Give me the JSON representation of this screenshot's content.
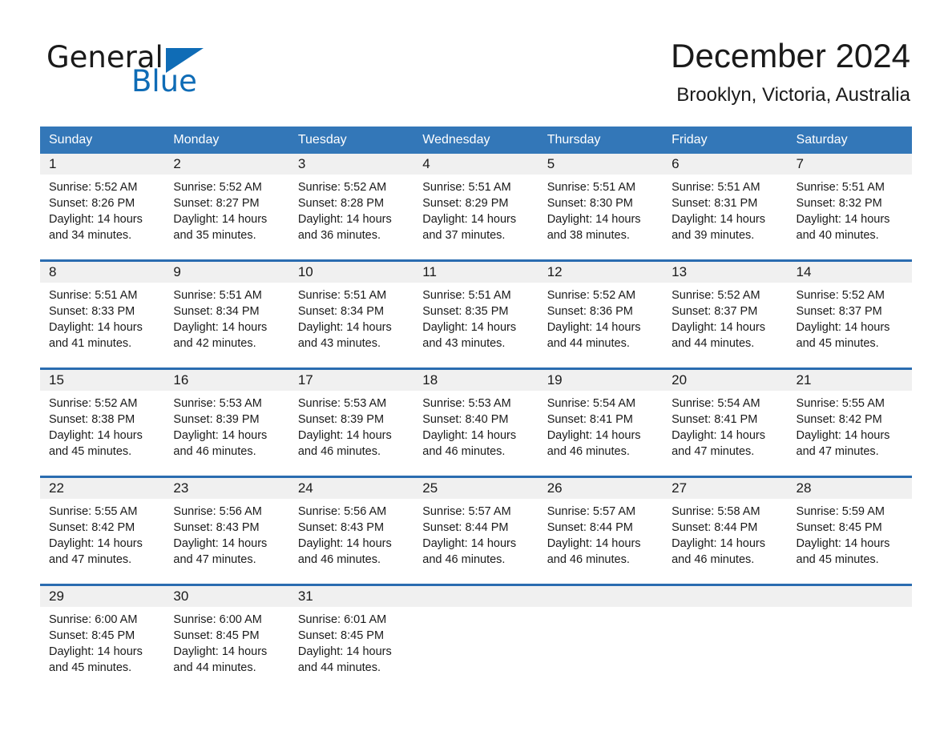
{
  "logo": {
    "word_one": "General",
    "word_two": "Blue",
    "triangle_color": "#0f6cb6",
    "icon": "triangle-logo-icon"
  },
  "header": {
    "month_title": "December 2024",
    "location": "Brooklyn, Victoria, Australia"
  },
  "colors": {
    "header_blue": "#3377b8",
    "row_divider_blue": "#2a6cb0",
    "daynum_background": "#f0f0f0",
    "brand_blue": "#0f6cb6"
  },
  "calendar": {
    "weekday_headers": [
      "Sunday",
      "Monday",
      "Tuesday",
      "Wednesday",
      "Thursday",
      "Friday",
      "Saturday"
    ],
    "weeks": [
      [
        {
          "day": "1",
          "sunrise": "Sunrise: 5:52 AM",
          "sunset": "Sunset: 8:26 PM",
          "daylight_line1": "Daylight: 14 hours",
          "daylight_line2": "and 34 minutes."
        },
        {
          "day": "2",
          "sunrise": "Sunrise: 5:52 AM",
          "sunset": "Sunset: 8:27 PM",
          "daylight_line1": "Daylight: 14 hours",
          "daylight_line2": "and 35 minutes."
        },
        {
          "day": "3",
          "sunrise": "Sunrise: 5:52 AM",
          "sunset": "Sunset: 8:28 PM",
          "daylight_line1": "Daylight: 14 hours",
          "daylight_line2": "and 36 minutes."
        },
        {
          "day": "4",
          "sunrise": "Sunrise: 5:51 AM",
          "sunset": "Sunset: 8:29 PM",
          "daylight_line1": "Daylight: 14 hours",
          "daylight_line2": "and 37 minutes."
        },
        {
          "day": "5",
          "sunrise": "Sunrise: 5:51 AM",
          "sunset": "Sunset: 8:30 PM",
          "daylight_line1": "Daylight: 14 hours",
          "daylight_line2": "and 38 minutes."
        },
        {
          "day": "6",
          "sunrise": "Sunrise: 5:51 AM",
          "sunset": "Sunset: 8:31 PM",
          "daylight_line1": "Daylight: 14 hours",
          "daylight_line2": "and 39 minutes."
        },
        {
          "day": "7",
          "sunrise": "Sunrise: 5:51 AM",
          "sunset": "Sunset: 8:32 PM",
          "daylight_line1": "Daylight: 14 hours",
          "daylight_line2": "and 40 minutes."
        }
      ],
      [
        {
          "day": "8",
          "sunrise": "Sunrise: 5:51 AM",
          "sunset": "Sunset: 8:33 PM",
          "daylight_line1": "Daylight: 14 hours",
          "daylight_line2": "and 41 minutes."
        },
        {
          "day": "9",
          "sunrise": "Sunrise: 5:51 AM",
          "sunset": "Sunset: 8:34 PM",
          "daylight_line1": "Daylight: 14 hours",
          "daylight_line2": "and 42 minutes."
        },
        {
          "day": "10",
          "sunrise": "Sunrise: 5:51 AM",
          "sunset": "Sunset: 8:34 PM",
          "daylight_line1": "Daylight: 14 hours",
          "daylight_line2": "and 43 minutes."
        },
        {
          "day": "11",
          "sunrise": "Sunrise: 5:51 AM",
          "sunset": "Sunset: 8:35 PM",
          "daylight_line1": "Daylight: 14 hours",
          "daylight_line2": "and 43 minutes."
        },
        {
          "day": "12",
          "sunrise": "Sunrise: 5:52 AM",
          "sunset": "Sunset: 8:36 PM",
          "daylight_line1": "Daylight: 14 hours",
          "daylight_line2": "and 44 minutes."
        },
        {
          "day": "13",
          "sunrise": "Sunrise: 5:52 AM",
          "sunset": "Sunset: 8:37 PM",
          "daylight_line1": "Daylight: 14 hours",
          "daylight_line2": "and 44 minutes."
        },
        {
          "day": "14",
          "sunrise": "Sunrise: 5:52 AM",
          "sunset": "Sunset: 8:37 PM",
          "daylight_line1": "Daylight: 14 hours",
          "daylight_line2": "and 45 minutes."
        }
      ],
      [
        {
          "day": "15",
          "sunrise": "Sunrise: 5:52 AM",
          "sunset": "Sunset: 8:38 PM",
          "daylight_line1": "Daylight: 14 hours",
          "daylight_line2": "and 45 minutes."
        },
        {
          "day": "16",
          "sunrise": "Sunrise: 5:53 AM",
          "sunset": "Sunset: 8:39 PM",
          "daylight_line1": "Daylight: 14 hours",
          "daylight_line2": "and 46 minutes."
        },
        {
          "day": "17",
          "sunrise": "Sunrise: 5:53 AM",
          "sunset": "Sunset: 8:39 PM",
          "daylight_line1": "Daylight: 14 hours",
          "daylight_line2": "and 46 minutes."
        },
        {
          "day": "18",
          "sunrise": "Sunrise: 5:53 AM",
          "sunset": "Sunset: 8:40 PM",
          "daylight_line1": "Daylight: 14 hours",
          "daylight_line2": "and 46 minutes."
        },
        {
          "day": "19",
          "sunrise": "Sunrise: 5:54 AM",
          "sunset": "Sunset: 8:41 PM",
          "daylight_line1": "Daylight: 14 hours",
          "daylight_line2": "and 46 minutes."
        },
        {
          "day": "20",
          "sunrise": "Sunrise: 5:54 AM",
          "sunset": "Sunset: 8:41 PM",
          "daylight_line1": "Daylight: 14 hours",
          "daylight_line2": "and 47 minutes."
        },
        {
          "day": "21",
          "sunrise": "Sunrise: 5:55 AM",
          "sunset": "Sunset: 8:42 PM",
          "daylight_line1": "Daylight: 14 hours",
          "daylight_line2": "and 47 minutes."
        }
      ],
      [
        {
          "day": "22",
          "sunrise": "Sunrise: 5:55 AM",
          "sunset": "Sunset: 8:42 PM",
          "daylight_line1": "Daylight: 14 hours",
          "daylight_line2": "and 47 minutes."
        },
        {
          "day": "23",
          "sunrise": "Sunrise: 5:56 AM",
          "sunset": "Sunset: 8:43 PM",
          "daylight_line1": "Daylight: 14 hours",
          "daylight_line2": "and 47 minutes."
        },
        {
          "day": "24",
          "sunrise": "Sunrise: 5:56 AM",
          "sunset": "Sunset: 8:43 PM",
          "daylight_line1": "Daylight: 14 hours",
          "daylight_line2": "and 46 minutes."
        },
        {
          "day": "25",
          "sunrise": "Sunrise: 5:57 AM",
          "sunset": "Sunset: 8:44 PM",
          "daylight_line1": "Daylight: 14 hours",
          "daylight_line2": "and 46 minutes."
        },
        {
          "day": "26",
          "sunrise": "Sunrise: 5:57 AM",
          "sunset": "Sunset: 8:44 PM",
          "daylight_line1": "Daylight: 14 hours",
          "daylight_line2": "and 46 minutes."
        },
        {
          "day": "27",
          "sunrise": "Sunrise: 5:58 AM",
          "sunset": "Sunset: 8:44 PM",
          "daylight_line1": "Daylight: 14 hours",
          "daylight_line2": "and 46 minutes."
        },
        {
          "day": "28",
          "sunrise": "Sunrise: 5:59 AM",
          "sunset": "Sunset: 8:45 PM",
          "daylight_line1": "Daylight: 14 hours",
          "daylight_line2": "and 45 minutes."
        }
      ],
      [
        {
          "day": "29",
          "sunrise": "Sunrise: 6:00 AM",
          "sunset": "Sunset: 8:45 PM",
          "daylight_line1": "Daylight: 14 hours",
          "daylight_line2": "and 45 minutes."
        },
        {
          "day": "30",
          "sunrise": "Sunrise: 6:00 AM",
          "sunset": "Sunset: 8:45 PM",
          "daylight_line1": "Daylight: 14 hours",
          "daylight_line2": "and 44 minutes."
        },
        {
          "day": "31",
          "sunrise": "Sunrise: 6:01 AM",
          "sunset": "Sunset: 8:45 PM",
          "daylight_line1": "Daylight: 14 hours",
          "daylight_line2": "and 44 minutes."
        },
        {
          "day": "",
          "sunrise": "",
          "sunset": "",
          "daylight_line1": "",
          "daylight_line2": ""
        },
        {
          "day": "",
          "sunrise": "",
          "sunset": "",
          "daylight_line1": "",
          "daylight_line2": ""
        },
        {
          "day": "",
          "sunrise": "",
          "sunset": "",
          "daylight_line1": "",
          "daylight_line2": ""
        },
        {
          "day": "",
          "sunrise": "",
          "sunset": "",
          "daylight_line1": "",
          "daylight_line2": ""
        }
      ]
    ]
  }
}
